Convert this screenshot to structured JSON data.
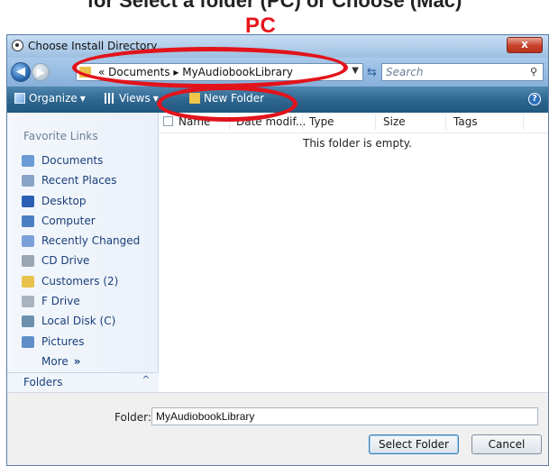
{
  "header_caption": "for Select a folder (PC) or Choose (Mac)",
  "platform_label": "PC",
  "window": {
    "title": "Choose Install Directory",
    "close_label": "x"
  },
  "address": {
    "path": "« Documents ▸ MyAudiobookLibrary",
    "search_placeholder": "Search"
  },
  "toolbar": {
    "organize_label": "Organize",
    "views_label": "Views",
    "new_folder_label": "New Folder",
    "help_label": "?"
  },
  "nav": {
    "header": "Favorite Links",
    "items": [
      {
        "label": "Documents",
        "icon": "documents-icon",
        "color": "#6b9ad6"
      },
      {
        "label": "Recent Places",
        "icon": "recent-places-icon",
        "color": "#8aa4c8"
      },
      {
        "label": "Desktop",
        "icon": "desktop-icon",
        "color": "#2b5fb3"
      },
      {
        "label": "Computer",
        "icon": "computer-icon",
        "color": "#4a7fc4"
      },
      {
        "label": "Recently Changed",
        "icon": "recently-changed-icon",
        "color": "#7aa0d8"
      },
      {
        "label": "CD Drive",
        "icon": "cd-drive-icon",
        "color": "#9aa6b2"
      },
      {
        "label": "Customers (2)",
        "icon": "folder-icon",
        "color": "#e8c24a"
      },
      {
        "label": "F Drive",
        "icon": "drive-icon",
        "color": "#a9b3bd"
      },
      {
        "label": "Local Disk (C)",
        "icon": "local-disk-icon",
        "color": "#6d8fae"
      },
      {
        "label": "Pictures",
        "icon": "pictures-icon",
        "color": "#5e8fc8"
      }
    ],
    "more_label": "More",
    "more_chevron": "»",
    "folders_label": "Folders",
    "folders_chevron": "^"
  },
  "columns": [
    "Name",
    "Date modif...",
    "Type",
    "Size",
    "Tags"
  ],
  "empty_message": "This folder is empty.",
  "footer": {
    "folder_label": "Folder:",
    "folder_value": "MyAudiobookLibrary",
    "select_label": "Select Folder",
    "cancel_label": "Cancel"
  }
}
